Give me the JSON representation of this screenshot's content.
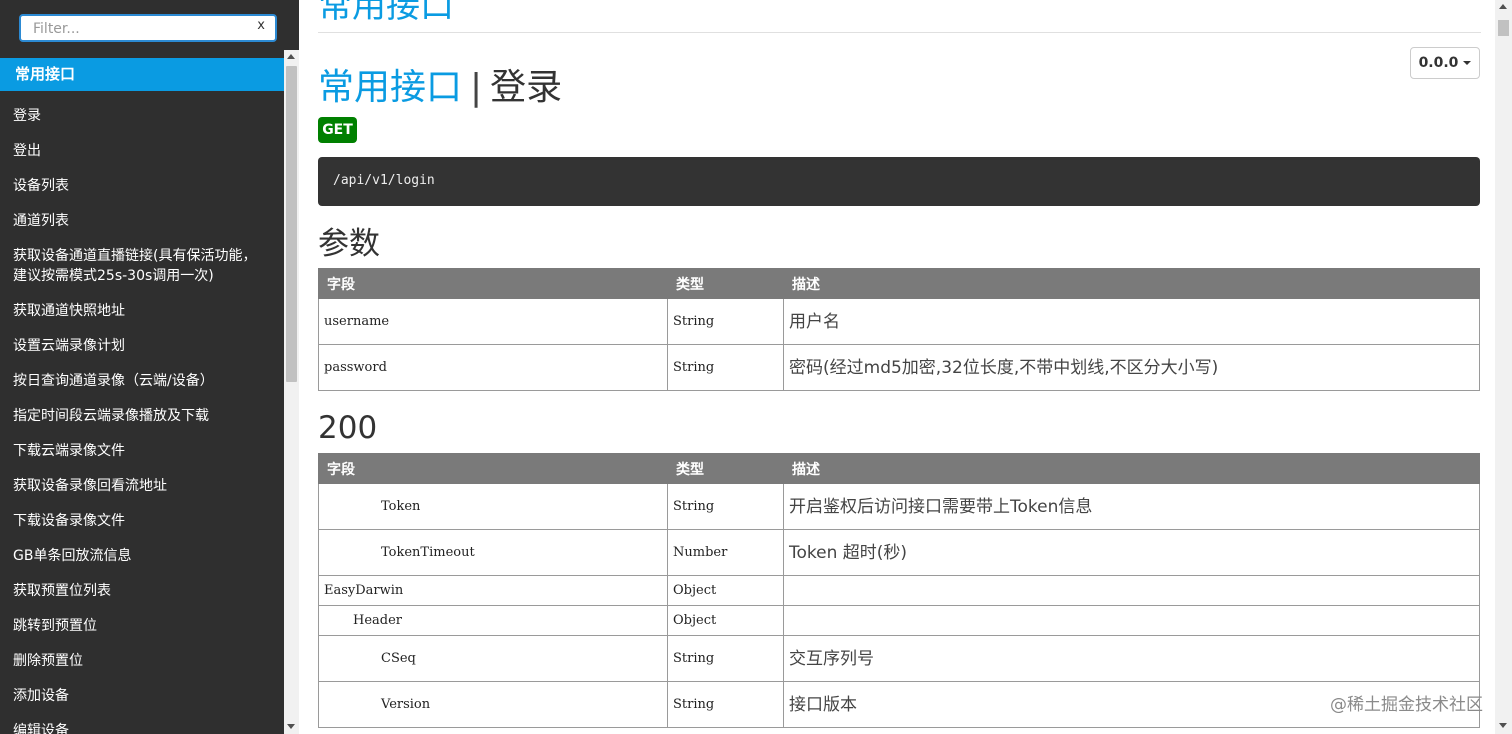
{
  "sidebar": {
    "filter_placeholder": "Filter...",
    "filter_clear": "x",
    "active_group": "常用接口",
    "items": [
      "登录",
      "登出",
      "设备列表",
      "通道列表",
      "获取设备通道直播链接(具有保活功能，建议按需模式25s-30s调用一次)",
      "获取通道快照地址",
      "设置云端录像计划",
      "按日查询通道录像（云端/设备）",
      "指定时间段云端录像播放及下载",
      "下载云端录像文件",
      "获取设备录像回看流地址",
      "下载设备录像文件",
      "GB单条回放流信息",
      "获取预置位列表",
      "跳转到预置位",
      "删除预置位",
      "添加设备",
      "编辑设备"
    ]
  },
  "main": {
    "group_heading": "常用接口",
    "version": "0.0.0",
    "title_group": "常用接口",
    "title_separator": "|",
    "title_name": "登录",
    "method": "GET",
    "url": "/api/v1/login",
    "params_title": "参数",
    "table_headers": [
      "字段",
      "类型",
      "描述"
    ],
    "params": [
      {
        "field": "username",
        "type": "String",
        "desc": "用户名"
      },
      {
        "field": "password",
        "type": "String",
        "desc": "密码(经过md5加密,32位长度,不带中划线,不区分大小写)"
      }
    ],
    "response_title": "200",
    "response": [
      {
        "field": "Token",
        "type": "String",
        "desc": "开启鉴权后访问接口需要带上Token信息",
        "indent": 2
      },
      {
        "field": "TokenTimeout",
        "type": "Number",
        "desc": "Token 超时(秒)",
        "indent": 2
      },
      {
        "field": "EasyDarwin",
        "type": "Object",
        "desc": "",
        "indent": 0
      },
      {
        "field": "Header",
        "type": "Object",
        "desc": "",
        "indent": 1
      },
      {
        "field": "CSeq",
        "type": "String",
        "desc": "交互序列号",
        "indent": 2
      },
      {
        "field": "Version",
        "type": "String",
        "desc": "接口版本",
        "indent": 2
      }
    ]
  },
  "watermark": "@稀土掘金技术社区",
  "colors": {
    "sidebar_bg": "#2f2f2f",
    "accent": "#0a9be2",
    "method_get": "#008000",
    "url_bg": "#333333",
    "table_header_bg": "#7a7a7a"
  }
}
